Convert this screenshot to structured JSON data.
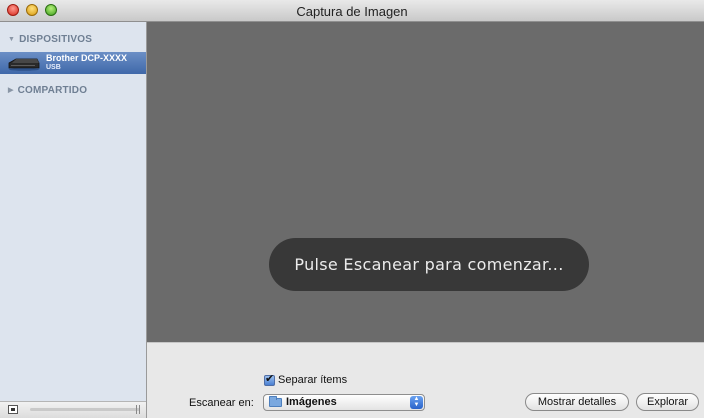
{
  "window": {
    "title": "Captura de Imagen"
  },
  "sidebar": {
    "devices_header": "DISPOSITIVOS",
    "device": {
      "name": "Brother  DCP-XXXX",
      "connection": "USB",
      "selected": true
    },
    "shared_header": "COMPARTIDO"
  },
  "preview": {
    "hud_message": "Pulse Escanear para comenzar..."
  },
  "controls": {
    "separate_items": {
      "label": "Separar ítems",
      "checked": true
    },
    "scan_to": {
      "label": "Escanear en:",
      "value": "Imágenes"
    },
    "show_details_label": "Mostrar detalles",
    "explore_label": "Explorar"
  },
  "colors": {
    "preview_bg": "#6b6b6b",
    "selection": "#4a72b0",
    "hud": "#383838"
  }
}
